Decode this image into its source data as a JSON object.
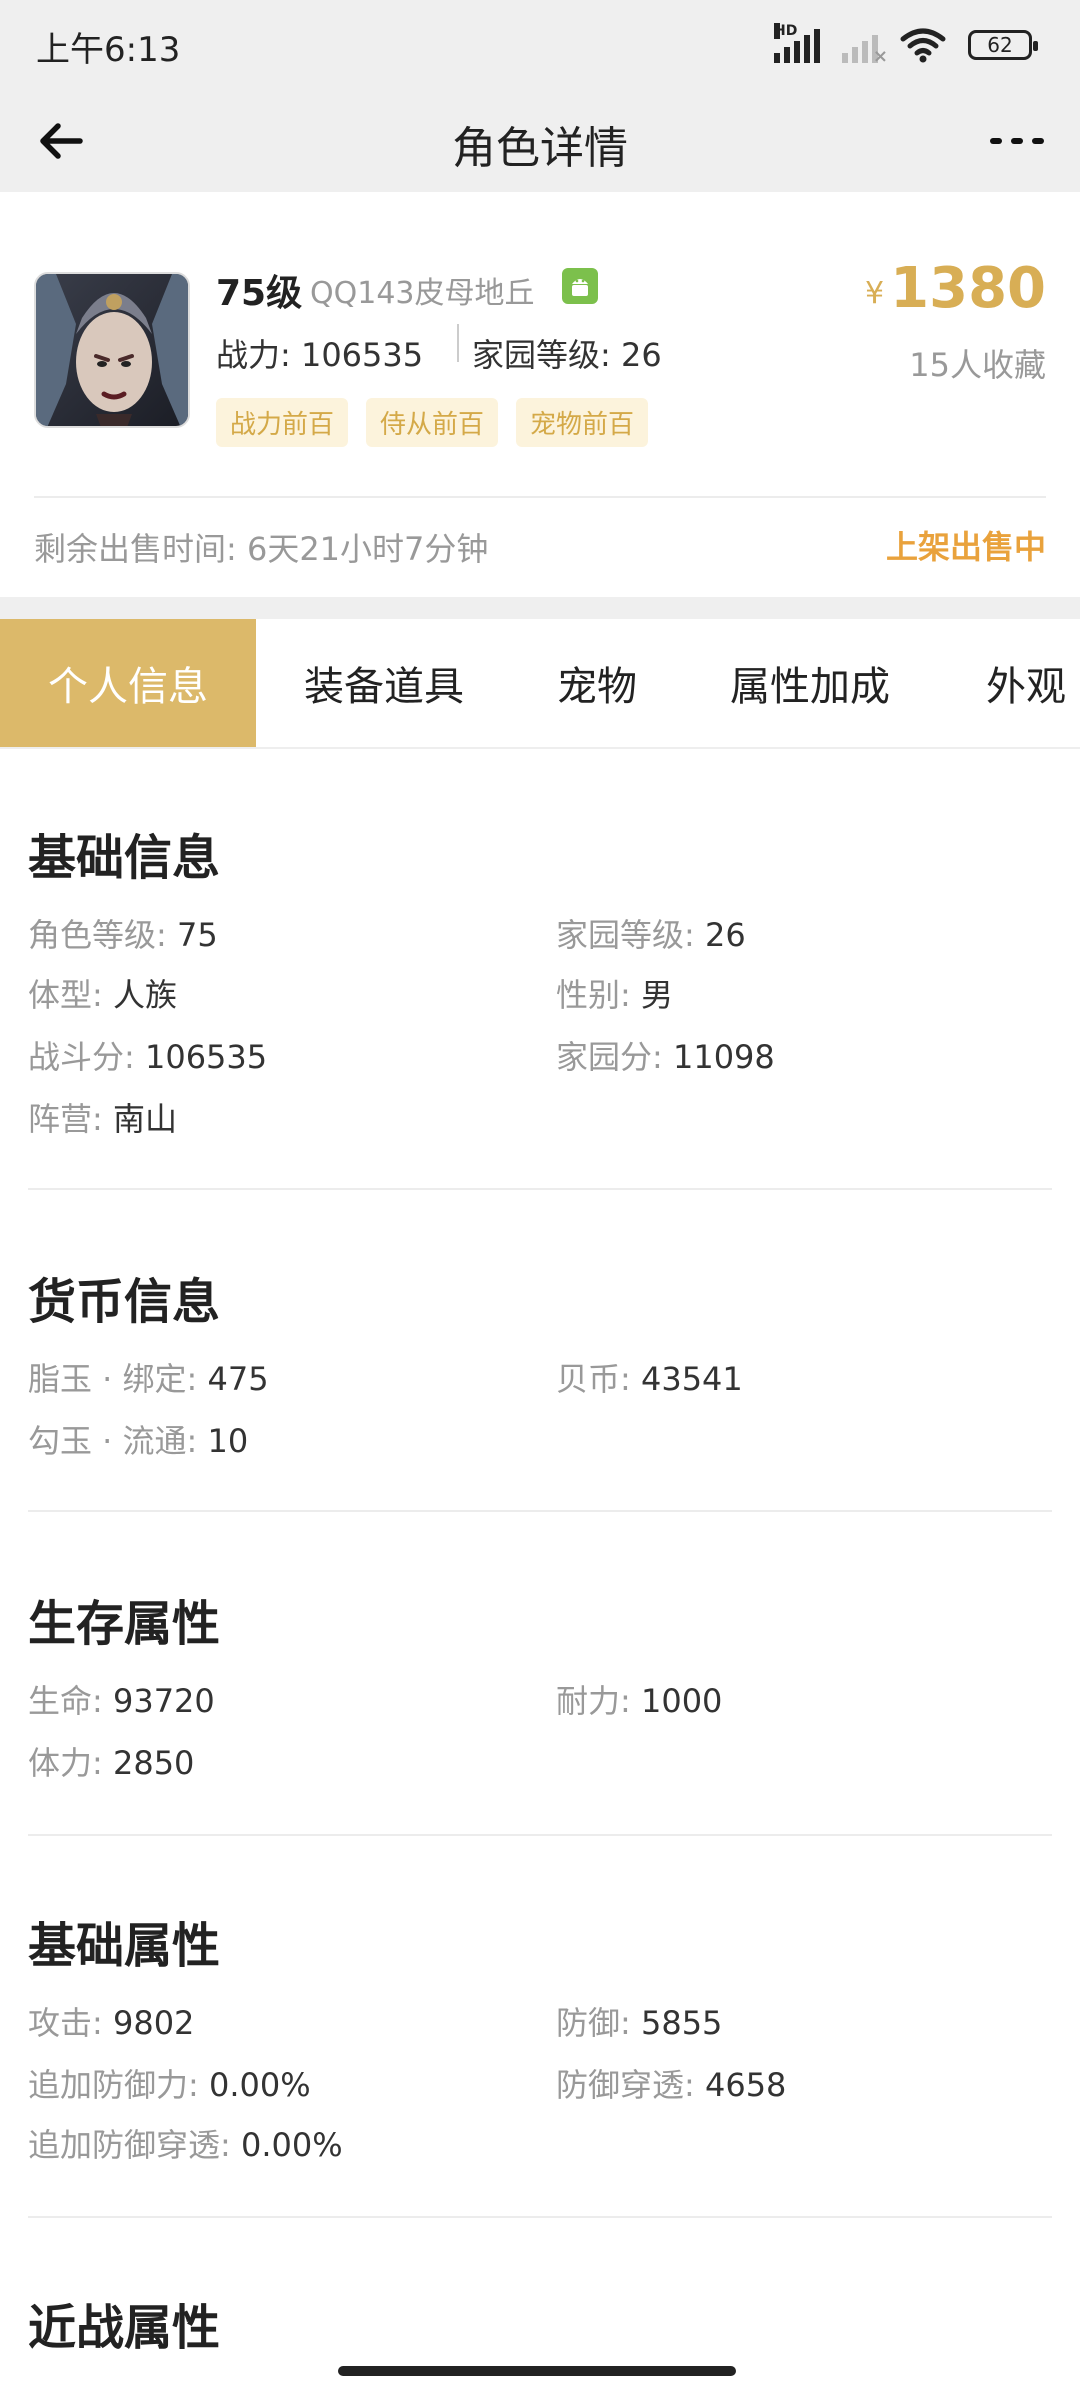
{
  "status_bar": {
    "time": "上午6:13",
    "hd": "HD",
    "battery": "62"
  },
  "app_bar": {
    "title": "角色详情"
  },
  "listing": {
    "level": "75级",
    "server": "QQ143皮母地丘",
    "power": "战力: 106535",
    "home_level": "家园等级: 26",
    "tags": [
      "战力前百",
      "侍从前百",
      "宠物前百"
    ],
    "currency_symbol": "¥",
    "price": "1380",
    "favorites": "15人收藏",
    "remaining": "剩余出售时间: 6天21小时7分钟",
    "status": "上架出售中"
  },
  "tabs": [
    "个人信息",
    "装备道具",
    "宠物",
    "属性加成",
    "外观"
  ],
  "sections": [
    {
      "title": "基础信息",
      "fields": [
        {
          "k": "角色等级",
          "v": "75"
        },
        {
          "k": "家园等级",
          "v": "26"
        },
        {
          "k": "体型",
          "v": "人族"
        },
        {
          "k": "性别",
          "v": "男"
        },
        {
          "k": "战斗分",
          "v": "106535"
        },
        {
          "k": "家园分",
          "v": "11098"
        },
        {
          "k": "阵营",
          "v": "南山"
        }
      ]
    },
    {
      "title": "货币信息",
      "fields": [
        {
          "k": "脂玉 · 绑定",
          "v": "475"
        },
        {
          "k": "贝币",
          "v": "43541"
        },
        {
          "k": "勾玉 · 流通",
          "v": "10"
        }
      ]
    },
    {
      "title": "生存属性",
      "fields": [
        {
          "k": "生命",
          "v": "93720"
        },
        {
          "k": "耐力",
          "v": "1000"
        },
        {
          "k": "体力",
          "v": "2850"
        }
      ]
    },
    {
      "title": "基础属性",
      "fields": [
        {
          "k": "攻击",
          "v": "9802"
        },
        {
          "k": "防御",
          "v": "5855"
        },
        {
          "k": "追加防御力",
          "v": "0.00%"
        },
        {
          "k": "防御穿透",
          "v": "4658"
        },
        {
          "k": "追加防御穿透",
          "v": "0.00%"
        }
      ]
    },
    {
      "title": "近战属性",
      "fields": []
    }
  ],
  "colors": {
    "accent": "#dcb96a",
    "price": "#d8ae55",
    "on_sale": "#e9a23c",
    "tag_bg": "#fcf3dc"
  }
}
